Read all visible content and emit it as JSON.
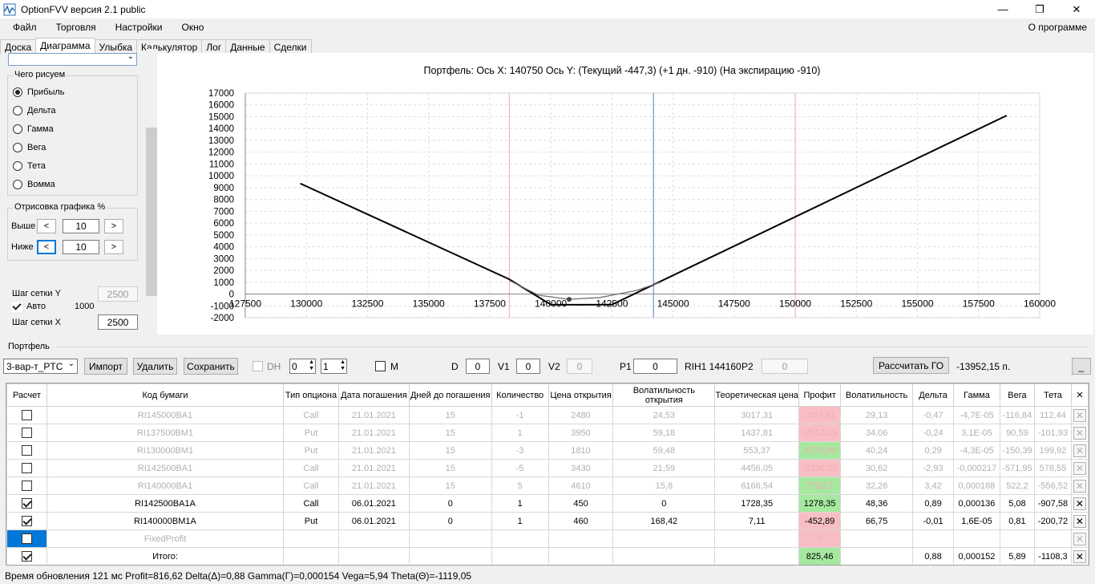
{
  "window": {
    "title": "OptionFVV версия 2.1 public",
    "min_label": "—",
    "max_label": "❐",
    "close_label": "✕"
  },
  "menu": {
    "items": [
      "Файл",
      "Торговля",
      "Настройки",
      "Окно"
    ],
    "about": "О программе"
  },
  "tabs": [
    "Доска",
    "Диаграмма",
    "Улыбка",
    "Калькулятор",
    "Лог",
    "Данные",
    "Сделки"
  ],
  "left": {
    "draw_group_title": "Чего рисуем",
    "radios": [
      {
        "label": "Прибыль",
        "on": true
      },
      {
        "label": "Дельта",
        "on": false
      },
      {
        "label": "Гамма",
        "on": false
      },
      {
        "label": "Вега",
        "on": false
      },
      {
        "label": "Тета",
        "on": false
      },
      {
        "label": "Вомма",
        "on": false
      }
    ],
    "render_group_title": "Отрисовка графика %",
    "above_label": "Выше",
    "above_value": "10",
    "below_label": "Ниже",
    "below_value": "10",
    "grid_y_label": "Шаг сетки Y",
    "grid_y_value": "2500",
    "auto_label": "Авто",
    "auto_value": "1000",
    "grid_x_label": "Шаг сетки X",
    "grid_x_value": "2500"
  },
  "chart_data": {
    "type": "line",
    "title": "Портфель:  Ось X:  140750  Ось Y:   (Текущий -447,3)   (+1 дн.  -910)   (На экспирацию  -910)",
    "xlim": [
      127500,
      160000
    ],
    "ylim": [
      -2000,
      17000
    ],
    "x_ticks": [
      127500,
      130000,
      132500,
      135000,
      137500,
      140000,
      142500,
      145000,
      147500,
      150000,
      152500,
      155000,
      157500,
      160000
    ],
    "x_tick_labels": [
      "127500",
      "130000",
      "132500",
      "135000",
      "137500",
      "140000",
      "142500",
      "145000",
      "147500",
      "150000",
      "152500",
      "155000",
      "157500",
      "160000"
    ],
    "y_ticks": [
      -2000,
      -1000,
      0,
      1000,
      2000,
      3000,
      4000,
      5000,
      6000,
      7000,
      8000,
      9000,
      10000,
      11000,
      12000,
      13000,
      14000,
      15000,
      16000,
      17000
    ],
    "y_tick_labels": [
      "-2000",
      "-1000",
      "0",
      "1000",
      "2000",
      "3000",
      "4000",
      "5000",
      "6000",
      "7000",
      "8000",
      "9000",
      "10000",
      "11000",
      "12000",
      "13000",
      "14000",
      "15000",
      "16000",
      "17000"
    ],
    "vlines": [
      {
        "x": 138300,
        "color": "#f4a6b4"
      },
      {
        "x": 144200,
        "color": "#5b7fb5"
      },
      {
        "x": 150000,
        "color": "#f4a6b4"
      }
    ],
    "series": [
      {
        "name": "",
        "color": "#000000",
        "x": [
          129750,
          138300,
          140000,
          141250,
          142500,
          158650
        ],
        "y": [
          9350,
          1250,
          -900,
          -910,
          -900,
          15100
        ]
      },
      {
        "name": "",
        "color": "#707070",
        "x": [
          138300,
          139500,
          140750,
          142000,
          143500,
          144500
        ],
        "y": [
          1150,
          -100,
          -447,
          -300,
          300,
          1000
        ]
      }
    ],
    "markers": [
      {
        "x": 140750,
        "y": -447
      }
    ],
    "grid": true
  },
  "portfolio": {
    "section_label": "Портфель",
    "combo_value": "3-вар-т_PTC",
    "import_label": "Импорт",
    "delete_label": "Удалить",
    "save_label": "Сохранить",
    "dh_label": "DH",
    "spin1": "0",
    "spin2": "1",
    "m_label": "M",
    "d_label": "D",
    "d_value": "0",
    "v1_label": "V1",
    "v1_value": "0",
    "v2_label": "V2",
    "v2_value": "0",
    "p1_label": "P1",
    "p1_value": "0",
    "ticker_info": "RIH1 144160",
    "p2_label": "P2",
    "p2_value": "0",
    "calc_go_label": "Рассчитать ГО",
    "go_value": "-13952,15 п.",
    "min_label": "_"
  },
  "table": {
    "headers": [
      "Расчет",
      "Код бумаги",
      "Тип опциона",
      "Дата погашения",
      "Дней до погашения",
      "Количество",
      "Цена открытия",
      "Волатильность открытия",
      "Теоретическая цена",
      "Профит",
      "Волатильность",
      "Дельта",
      "Гамма",
      "Вега",
      "Тета",
      "✕"
    ],
    "rows": [
      {
        "check": false,
        "gray": true,
        "profit": "red",
        "cells": [
          "RI145000BA1",
          "Call",
          "21.01.2021",
          "15",
          "-1",
          "2480",
          "24,53",
          "3017,31",
          "-537,31",
          "29,13",
          "-0,47",
          "-4,7E-05",
          "-116,84",
          "112,44"
        ]
      },
      {
        "check": false,
        "gray": true,
        "profit": "red",
        "cells": [
          "RI137500BM1",
          "Put",
          "21.01.2021",
          "15",
          "1",
          "3950",
          "59,18",
          "1437,81",
          "-2512,19",
          "34,06",
          "-0,24",
          "3,1E-05",
          "90,59",
          "-101,93"
        ]
      },
      {
        "check": false,
        "gray": true,
        "profit": "green",
        "cells": [
          "RI130000BM1",
          "Put",
          "21.01.2021",
          "15",
          "-3",
          "1810",
          "59,48",
          "553,37",
          "3770,89",
          "40,24",
          "0,29",
          "-4,3E-05",
          "-150,39",
          "199,92"
        ]
      },
      {
        "check": false,
        "gray": true,
        "profit": "red",
        "cells": [
          "RI142500BA1",
          "Call",
          "21.01.2021",
          "15",
          "-5",
          "3430",
          "21,59",
          "4456,05",
          "-5130,25",
          "30,62",
          "-2,93",
          "-0,000217",
          "-571,95",
          "578,55"
        ]
      },
      {
        "check": false,
        "gray": true,
        "profit": "green",
        "cells": [
          "RI140000BA1",
          "Call",
          "21.01.2021",
          "15",
          "5",
          "4610",
          "15,8",
          "6166,54",
          "7782,7",
          "32,26",
          "3,42",
          "0,000188",
          "522,2",
          "-556,52"
        ]
      },
      {
        "check": true,
        "gray": false,
        "profit": "green",
        "cells": [
          "RI142500BA1A",
          "Call",
          "06.01.2021",
          "0",
          "1",
          "450",
          "0",
          "1728,35",
          "1278,35",
          "48,36",
          "0,89",
          "0,000136",
          "5,08",
          "-907,58"
        ]
      },
      {
        "check": true,
        "gray": false,
        "profit": "red",
        "cells": [
          "RI140000BM1A",
          "Put",
          "06.01.2021",
          "0",
          "1",
          "460",
          "168,42",
          "7,11",
          "-452,89",
          "66,75",
          "-0,01",
          "1,6E-05",
          "0,81",
          "-200,72"
        ]
      },
      {
        "check": false,
        "gray": true,
        "profit": "red",
        "selected": true,
        "cells": [
          "FixedProfit",
          "",
          "",
          "",
          "",
          "",
          "",
          "",
          "0",
          "",
          "",
          "",
          "",
          ""
        ]
      },
      {
        "check": true,
        "gray": false,
        "profit": "green",
        "cells": [
          "Итого:",
          "",
          "",
          "",
          "",
          "",
          "",
          "",
          "825,46",
          "",
          "0,88",
          "0,000152",
          "5,89",
          "-1108,3"
        ]
      }
    ]
  },
  "status": "Время обновления 121 мс  Profit=816,62 Delta(Δ)=0,88 Gamma(Γ)=0,000154 Vega=5,94 Theta(Θ)=-1119,05"
}
